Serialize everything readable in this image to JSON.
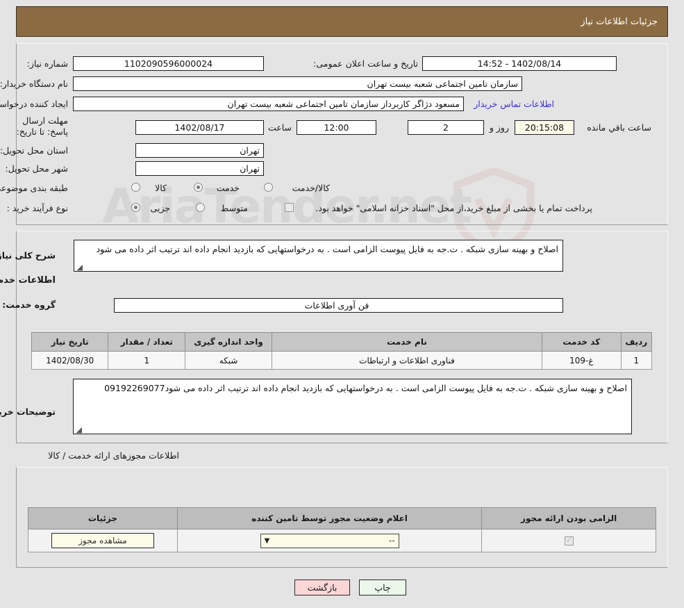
{
  "header": {
    "title": "جزئیات اطلاعات نیاز"
  },
  "top": {
    "need_number_label": "شماره نیاز:",
    "need_number": "1102090596000024",
    "announce_label": "تاریخ و ساعت اعلان عمومی:",
    "announce_value": "14:52 - 1402/08/14",
    "buyer_org_label": "نام دستگاه خریدار:",
    "buyer_org": "سازمان تامین اجتماعی شعبه بیست تهران",
    "creator_label": "ایجاد کننده درخواست:",
    "creator": "مسعود دژاگر کاربرداز سازمان تامین اجتماعی شعبه بیست تهران",
    "contact_link": "اطلاعات تماس خریدار",
    "deadline_label": "مهلت ارسال پاسخ: تا تاریخ:",
    "deadline_date": "1402/08/17",
    "hour_label": "ساعت",
    "deadline_time": "12:00",
    "days_value": "2",
    "days_label": "روز و",
    "countdown": "20:15:08",
    "remaining_label": "ساعت باقي مانده",
    "province_label": "استان محل تحویل:",
    "province": "تهران",
    "city_label": "شهر محل تحویل:",
    "city": "تهران",
    "category_label": "طبقه بندی موضوعی:",
    "category_options": [
      "کالا",
      "خدمت",
      "کالا/خدمت"
    ],
    "category_selected": 1,
    "process_label": "نوع فرآیند خرید :",
    "process_options": [
      "جزیی",
      "متوسط"
    ],
    "process_selected": 0,
    "treasury_note": "پرداخت تمام یا بخشی از مبلغ خرید،از محل \"اسناد خزانه اسلامی\" خواهد بود.",
    "treasury_checked": false
  },
  "mid": {
    "summary_label": "شرح کلی نیاز:",
    "summary_text": "اصلاح و بهینه سازی شبکه . ت.جه به فایل پیوست الزامی است . به درخواستهایی که بازدید انجام داده اند ترتیب اثر داده می شود",
    "services_heading": "اطلاعات خدمات مورد نیاز",
    "service_group_label": "گروه خدمت:",
    "service_group": "فن آوری اطلاعات",
    "table": {
      "columns": [
        "ردیف",
        "کد خدمت",
        "نام خدمت",
        "واحد اندازه گیری",
        "تعداد / مقدار",
        "تاریخ نیاز"
      ],
      "rows": [
        [
          "1",
          "غ-109",
          "فناوری اطلاعات و ارتباطات",
          "شبکه",
          "1",
          "1402/08/30"
        ]
      ]
    },
    "notes_label": "توضیحات خریدار:",
    "notes_text": "اصلاح و بهینه سازی شبکه . ت.جه به فایل پیوست الزامی است . به درخواستهایی که بازدید انجام داده اند ترتیب اثر داده می شود09192269077"
  },
  "permits": {
    "section_label": "اطلاعات مجوزهای ارائه خدمت / کالا",
    "columns": [
      "الزامی بودن ارائه مجوز",
      "اعلام وضعیت مجوز توسط تامین کننده",
      "جزئیات"
    ],
    "rows": [
      {
        "required": true,
        "status": "--",
        "details_button": "مشاهده مجوز"
      }
    ]
  },
  "footer": {
    "print_label": "چاپ",
    "back_label": "بازگشت"
  },
  "watermark": {
    "text": "AriaTender.net"
  },
  "colors": {
    "title_bar": "#8b6c42",
    "page_bg": "#e4e4e4",
    "link": "#3b2fd4",
    "print_btn": "#eaf7ea",
    "back_btn": "#fbd6d6",
    "table_header": "#c6c6c6"
  }
}
